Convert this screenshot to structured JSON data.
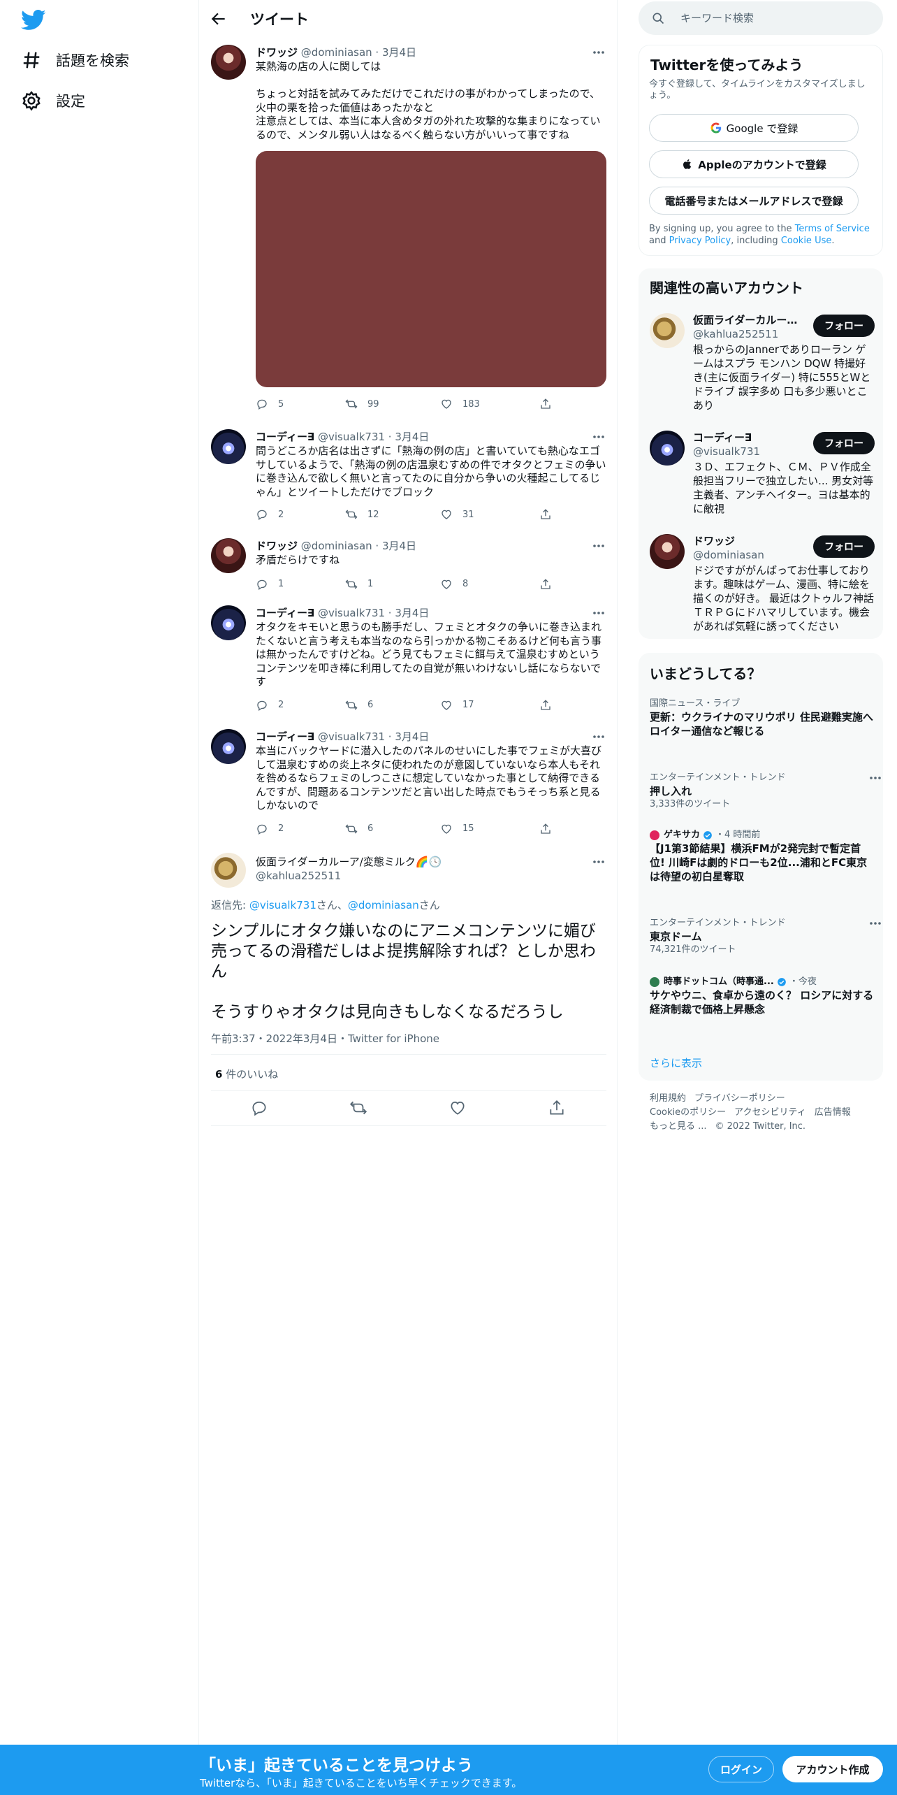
{
  "nav": {
    "logo_icon": "twitter-bird-icon",
    "explore_label": "話題を検索",
    "settings_label": "設定"
  },
  "header": {
    "title": "ツイート"
  },
  "thread": [
    {
      "name": "ドワッジ",
      "handle": "@dominiasan",
      "date": "3月4日",
      "text": "某熱海の店の人に関しては\n\nちょっと対話を試みてみただけでこれだけの事がわかってしまったので、火中の栗を拾った価値はあったかなと\n注意点としては、本当に本人含めタガの外れた攻撃的な集まりになっているので、メンタル弱い人はなるべく触らない方がいいって事ですね",
      "replies": "5",
      "retweets": "99",
      "likes": "183"
    },
    {
      "name": "コーディー∃",
      "handle": "@visualk731",
      "date": "3月4日",
      "text": "問うどころか店名は出さずに「熱海の例の店」と書いていても熱心なエゴサしているようで、「熱海の例の店温泉むすめの件でオタクとフェミの争いに巻き込んで欲しく無いと言ってたのに自分から争いの火種起こしてるじゃん」とツイートしただけでブロック",
      "replies": "2",
      "retweets": "12",
      "likes": "31"
    },
    {
      "name": "ドワッジ",
      "handle": "@dominiasan",
      "date": "3月4日",
      "text": "矛盾だらけですね",
      "replies": "1",
      "retweets": "1",
      "likes": "8"
    },
    {
      "name": "コーディー∃",
      "handle": "@visualk731",
      "date": "3月4日",
      "text": "オタクをキモいと思うのも勝手だし、フェミとオタクの争いに巻き込まれたくないと言う考えも本当なのなら引っかかる物こそあるけど何も言う事は無かったんですけどね。どう見てもフェミに餌与えて温泉むすめというコンテンツを叩き棒に利用してたの自覚が無いわけないし話にならないです",
      "replies": "2",
      "retweets": "6",
      "likes": "17"
    },
    {
      "name": "コーディー∃",
      "handle": "@visualk731",
      "date": "3月4日",
      "text": "本当にバックヤードに潜入したのパネルのせいにした事でフェミが大喜びして温泉むすめの炎上ネタに使われたのが意図していないなら本人もそれを咎めるならフェミのしつこさに想定していなかった事として納得できるんですが、問題あるコンテンツだと言い出した時点でもうそっち系と見るしかないので",
      "replies": "2",
      "retweets": "6",
      "likes": "15"
    }
  ],
  "focus": {
    "name": "仮面ライダーカルーア/変態ミルク🌈🕓",
    "handle": "@kahlua252511",
    "reply_prefix": "返信先: ",
    "reply_user1": "@visualk731",
    "reply_san1": "さん、",
    "reply_user2": "@dominiasan",
    "reply_san2": "さん",
    "text": "シンプルにオタク嫌いなのにアニメコンテンツに媚び売ってるの滑稽だしはよ提携解除すれば？としか思わん\n\nそうすりゃオタクは見向きもしなくなるだろうし",
    "meta": "午前3:37・2022年3月4日・Twitter for iPhone",
    "likes_count": "6",
    "likes_label": " 件のいいね"
  },
  "search": {
    "placeholder": "キーワード検索"
  },
  "signup": {
    "title": "Twitterを使ってみよう",
    "subtitle": "今すぐ登録して、タイムラインをカスタマイズしましょう。",
    "google_label": "Google で登録",
    "apple_label": "Appleのアカウントで登録",
    "phone_label": "電話番号またはメールアドレスで登録",
    "terms_pre": "By signing up, you agree to the ",
    "terms_link": "Terms of Service",
    "terms_and": " and ",
    "privacy_link": "Privacy Policy",
    "terms_including": ", including ",
    "cookie_link": "Cookie Use",
    "terms_end": "."
  },
  "related": {
    "title": "関連性の高いアカウント",
    "follow_label": "フォロー",
    "accounts": [
      {
        "name": "仮面ライダーカルー...",
        "handle": "@kahlua252511",
        "bio": "根っからのJannerでありローラン ゲームはスプラ モンハン DQW 特撮好き(主に仮面ライダー) 特に555とWとドライブ 誤字多め 口も多少悪いとこあり"
      },
      {
        "name": "コーディー∃",
        "handle": "@visualk731",
        "bio": "３Ｄ、エフェクト、ＣＭ、ＰＶ作成全般担当フリーで独立したい... 男女対等主義者、アンチヘイター。ヨは基本的に敵視"
      },
      {
        "name": "ドワッジ",
        "handle": "@dominiasan",
        "bio": "ドジですががんばってお仕事しております。趣味はゲーム、漫画、特に絵を描くのが好き。 最近はクトゥルフ神話ＴＲＰＧにドハマリしています。機会があれば気軽に誘ってください"
      }
    ]
  },
  "trends": {
    "title": "いまどうしてる？",
    "items": [
      {
        "category": "国際ニュース・ライブ",
        "title": "更新：ウクライナのマリウポリ 住民避難実施へ ロイター通信など報じる",
        "count": ""
      },
      {
        "category": "エンターテインメント・トレンド",
        "title": "押し入れ",
        "count": "3,333件のツイート"
      },
      {
        "category": "ゲキサカ",
        "time": "・4 時間前",
        "title": "【J1第3節結果】横浜FMが2発完封で暫定首位! 川崎Fは劇的ドローも2位...浦和とFC東京は待望の初白星奪取",
        "count": ""
      },
      {
        "category": "エンターテインメント・トレンド",
        "title": "東京ドーム",
        "count": "74,321件のツイート"
      },
      {
        "category": "時事ドットコム（時事通...",
        "time": "・今夜",
        "title": "サケやウニ、食卓から遠のく？ ロシアに対する経済制裁で価格上昇懸念",
        "count": ""
      }
    ],
    "show_more": "さらに表示"
  },
  "footer": {
    "links": [
      "利用規約",
      "プライバシーポリシー",
      "Cookieのポリシー",
      "アクセシビリティ",
      "広告情報",
      "もっと見る ..."
    ],
    "copyright": "© 2022 Twitter, Inc."
  },
  "bottom_bar": {
    "title": "「いま」起きていることを見つけよう",
    "subtitle": "Twitterなら、「いま」起きていることをいち早くチェックできます。",
    "login_label": "ログイン",
    "signup_label": "アカウント作成"
  },
  "colors": {
    "brand": "#1d9bf0",
    "text": "#0f1419",
    "secondary": "#536471",
    "media_placeholder": "#7a3b3b"
  }
}
